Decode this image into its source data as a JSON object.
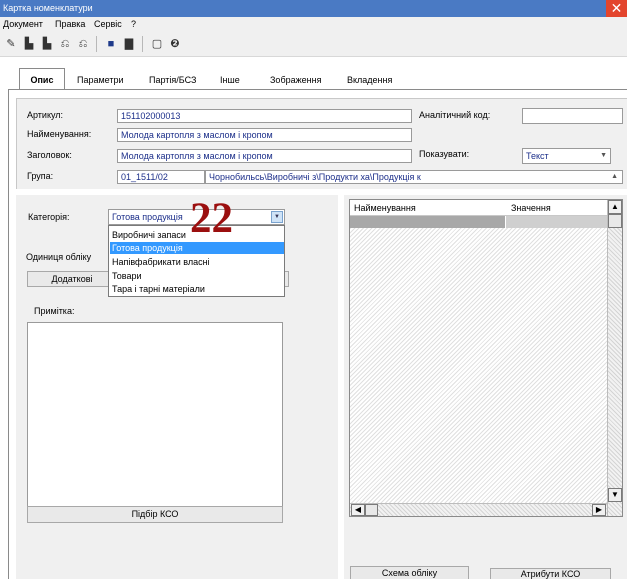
{
  "window": {
    "title": "Картка номенклатури",
    "close_glyph": "✕"
  },
  "menu": [
    "Документ",
    "Правка",
    "Сервіс",
    "?"
  ],
  "toolbar": {
    "icons": [
      "new-doc-icon",
      "open-folder-icon",
      "copy-icon",
      "new-item-icon",
      "new-copy-icon",
      "save-icon",
      "print-icon",
      "form-icon",
      "help-icon"
    ]
  },
  "tabs": [
    {
      "label": "Опис",
      "active": true
    },
    {
      "label": "Параметри"
    },
    {
      "label": "Партія/БСЗ"
    },
    {
      "label": "Інше"
    },
    {
      "label": "Зображення"
    },
    {
      "label": "Вкладення"
    }
  ],
  "form": {
    "article_label": "Артикул:",
    "article_value": "151102000013",
    "analytic_label": "Аналітичний код:",
    "analytic_value": "",
    "name_label": "Найменування:",
    "name_value": "Молода картопля з маслом і кропом",
    "header_label": "Заголовок:",
    "header_value": "Молода картопля з маслом і кропом",
    "show_label": "Показувати:",
    "show_value": "Текст",
    "group_label": "Група:",
    "group_code": "01_1511/02",
    "group_path": "Чорнобильсь\\Виробничі з\\Продукти ха\\Продукція к"
  },
  "category": {
    "label": "Категорія:",
    "value": "Готова продукція",
    "options": [
      "Виробничі запаси",
      "Готова продукція",
      "Напівфабрикати власні",
      "Товари",
      "Тара і тарні матеріали"
    ],
    "selected_index": 1
  },
  "units": {
    "label": "Одиниця обліку",
    "extra_button": "Додаткові"
  },
  "note": {
    "label": "Примітка:"
  },
  "buttons": {
    "kso_pick": "Підбір КСО",
    "scheme": "Схема обліку",
    "kso_attrs": "Атрибути КСО"
  },
  "grid": {
    "columns": [
      "Найменування",
      "Значення"
    ]
  },
  "annotation": "22",
  "colors": {
    "titlebar": "#4a7ac4",
    "close": "#e3452d",
    "field_text": "#1c2f8a",
    "selection": "#3399ff",
    "annotation": "#9b0f0f"
  }
}
